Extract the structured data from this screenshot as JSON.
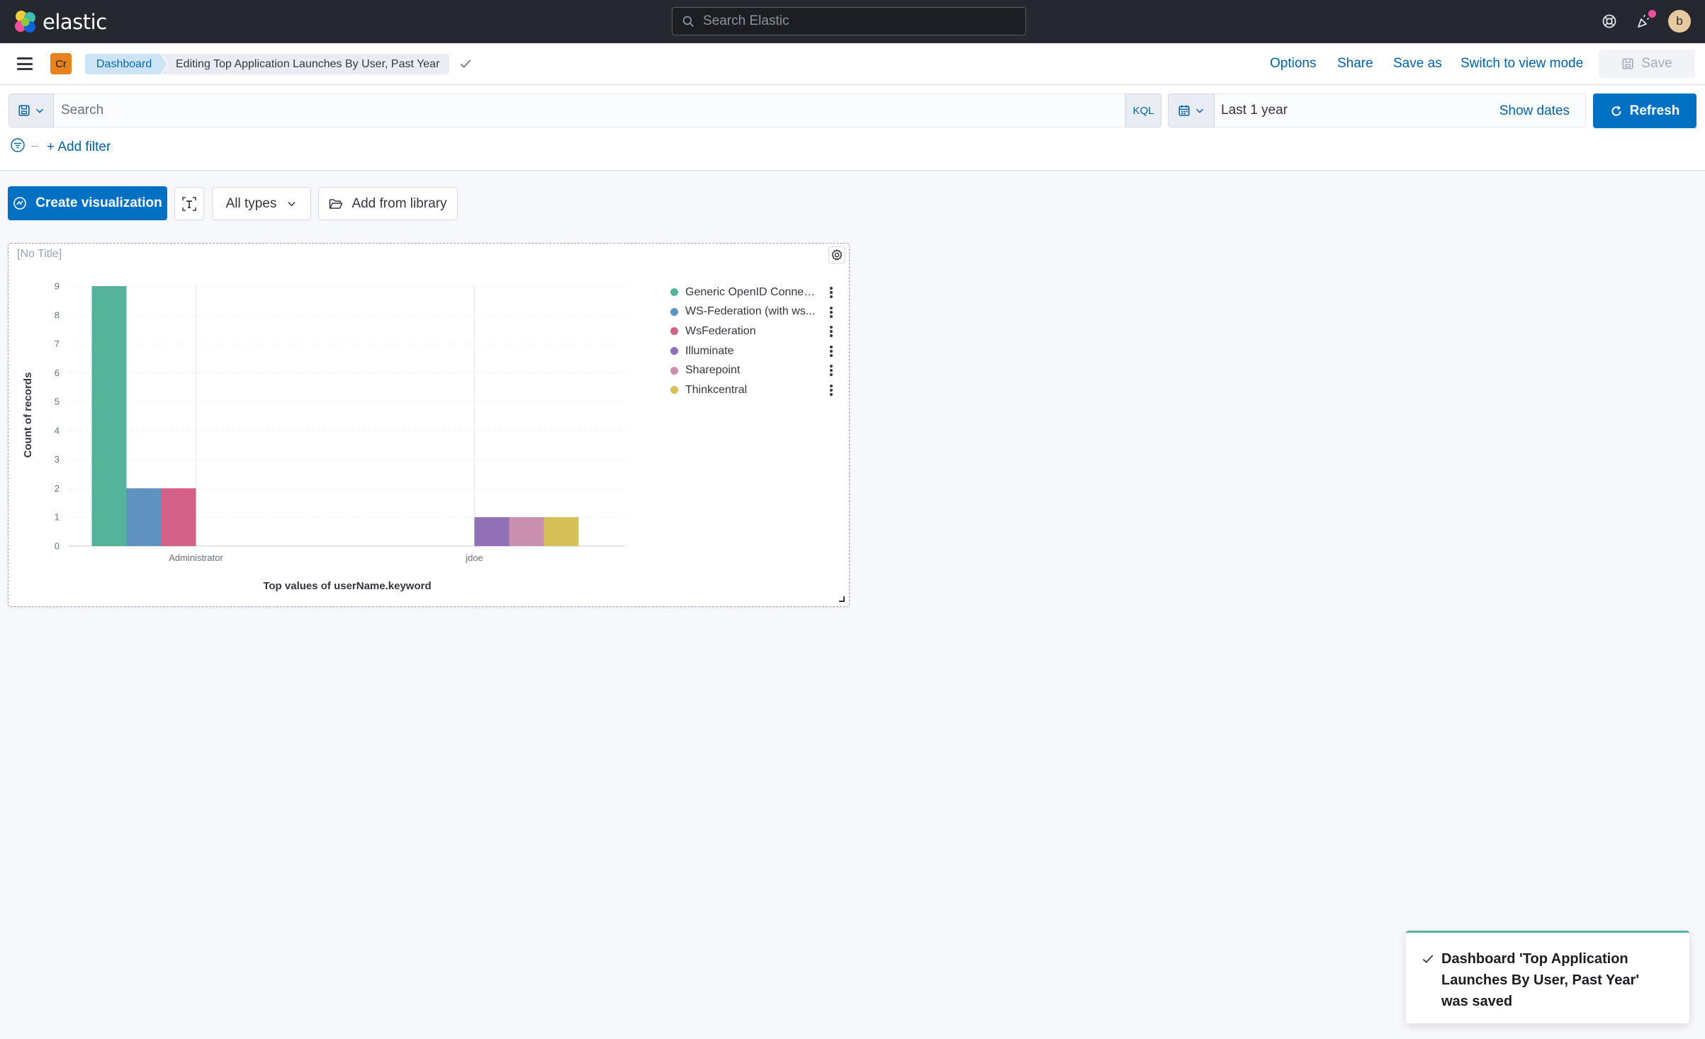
{
  "header": {
    "logo_text": "elastic",
    "search_placeholder": "Search Elastic",
    "avatar_initial": "b"
  },
  "nav": {
    "space_badge": "Cr",
    "breadcrumb_root": "Dashboard",
    "breadcrumb_current": "Editing Top Application Launches By User, Past Year",
    "links": {
      "options": "Options",
      "share": "Share",
      "save_as": "Save as",
      "switch_mode": "Switch to view mode"
    },
    "save_label": "Save"
  },
  "query": {
    "search_placeholder": "Search",
    "language": "KQL",
    "time_range": "Last 1 year",
    "show_dates": "Show dates",
    "refresh_label": "Refresh",
    "add_filter": "+ Add filter"
  },
  "toolbar": {
    "create_label": "Create visualization",
    "types_label": "All types",
    "library_label": "Add from library"
  },
  "panel": {
    "title": "[No Title]"
  },
  "chart_data": {
    "type": "bar",
    "xlabel": "Top values of userName.keyword",
    "ylabel": "Count of records",
    "categories": [
      "Administrator",
      "jdoe"
    ],
    "ylim": [
      0,
      9
    ],
    "yticks": [
      0,
      1,
      2,
      3,
      4,
      5,
      6,
      7,
      8,
      9
    ],
    "legend_position": "right",
    "series": [
      {
        "name": "Generic OpenID Connec...",
        "color": "#54b399",
        "values": [
          9,
          0
        ]
      },
      {
        "name": "WS-Federation (with ws...",
        "color": "#6092c0",
        "values": [
          2,
          0
        ]
      },
      {
        "name": "WsFederation",
        "color": "#d36086",
        "values": [
          2,
          0
        ]
      },
      {
        "name": "Illuminate",
        "color": "#9170b8",
        "values": [
          0,
          1
        ]
      },
      {
        "name": "Sharepoint",
        "color": "#ca8eae",
        "values": [
          0,
          1
        ]
      },
      {
        "name": "Thinkcentral",
        "color": "#d6bf57",
        "values": [
          0,
          1
        ]
      }
    ]
  },
  "toast": {
    "message": "Dashboard 'Top Application Launches By User, Past Year' was saved",
    "color": "#54b399"
  }
}
